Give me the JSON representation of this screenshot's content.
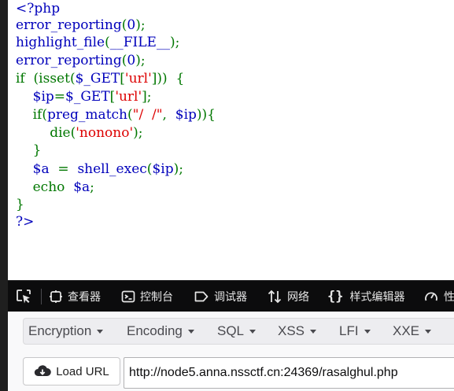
{
  "code": {
    "lines": [
      [
        {
          "t": "<?php",
          "c": "default"
        }
      ],
      [
        {
          "t": "error_reporting",
          "c": "default"
        },
        {
          "t": "(",
          "c": "keyword"
        },
        {
          "t": "0",
          "c": "default"
        },
        {
          "t": ");",
          "c": "keyword"
        }
      ],
      [
        {
          "t": "highlight_file",
          "c": "default"
        },
        {
          "t": "(",
          "c": "keyword"
        },
        {
          "t": "__FILE__",
          "c": "default"
        },
        {
          "t": ");",
          "c": "keyword"
        }
      ],
      [
        {
          "t": "error_reporting",
          "c": "default"
        },
        {
          "t": "(",
          "c": "keyword"
        },
        {
          "t": "0",
          "c": "default"
        },
        {
          "t": ");",
          "c": "keyword"
        }
      ],
      [
        {
          "t": "if  (isset(",
          "c": "keyword"
        },
        {
          "t": "$_GET",
          "c": "default"
        },
        {
          "t": "[",
          "c": "keyword"
        },
        {
          "t": "'url'",
          "c": "string"
        },
        {
          "t": "]))  {",
          "c": "keyword"
        }
      ],
      [
        {
          "t": "    ",
          "c": "keyword"
        },
        {
          "t": "$ip",
          "c": "default"
        },
        {
          "t": "=",
          "c": "keyword"
        },
        {
          "t": "$_GET",
          "c": "default"
        },
        {
          "t": "[",
          "c": "keyword"
        },
        {
          "t": "'url'",
          "c": "string"
        },
        {
          "t": "];",
          "c": "keyword"
        }
      ],
      [
        {
          "t": "    if(",
          "c": "keyword"
        },
        {
          "t": "preg_match",
          "c": "default"
        },
        {
          "t": "(",
          "c": "keyword"
        },
        {
          "t": "\"/  /\"",
          "c": "string"
        },
        {
          "t": ",  ",
          "c": "keyword"
        },
        {
          "t": "$ip",
          "c": "default"
        },
        {
          "t": ")){",
          "c": "keyword"
        }
      ],
      [
        {
          "t": "        die(",
          "c": "keyword"
        },
        {
          "t": "'nonono'",
          "c": "string"
        },
        {
          "t": ");",
          "c": "keyword"
        }
      ],
      [
        {
          "t": "    }",
          "c": "keyword"
        }
      ],
      [
        {
          "t": "    ",
          "c": "keyword"
        },
        {
          "t": "$a  ",
          "c": "default"
        },
        {
          "t": "=  ",
          "c": "keyword"
        },
        {
          "t": "shell_exec",
          "c": "default"
        },
        {
          "t": "(",
          "c": "keyword"
        },
        {
          "t": "$ip",
          "c": "default"
        },
        {
          "t": ");",
          "c": "keyword"
        }
      ],
      [
        {
          "t": "    echo  ",
          "c": "keyword"
        },
        {
          "t": "$a",
          "c": "default"
        },
        {
          "t": ";",
          "c": "keyword"
        }
      ],
      [
        {
          "t": "}",
          "c": "keyword"
        }
      ],
      [
        {
          "t": "?>",
          "c": "default"
        }
      ]
    ],
    "colors": {
      "default": "#0000bb",
      "keyword": "#007700",
      "string": "#dd0000"
    }
  },
  "devtools": {
    "tabs": [
      {
        "id": "inspector",
        "label": "查看器",
        "icon": "inspector-icon"
      },
      {
        "id": "console",
        "label": "控制台",
        "icon": "console-icon"
      },
      {
        "id": "debugger",
        "label": "调试器",
        "icon": "debugger-icon"
      },
      {
        "id": "network",
        "label": "网络",
        "icon": "network-icon"
      },
      {
        "id": "style-editor",
        "label": "样式编辑器",
        "icon": "style-editor-icon"
      },
      {
        "id": "performance",
        "label": "性",
        "icon": "performance-icon"
      }
    ],
    "picker_icon": "element-picker-icon",
    "background": "#0c0c0d"
  },
  "hackbar": {
    "menus": [
      {
        "id": "encryption",
        "label": "Encryption"
      },
      {
        "id": "encoding",
        "label": "Encoding"
      },
      {
        "id": "sql",
        "label": "SQL"
      },
      {
        "id": "xss",
        "label": "XSS"
      },
      {
        "id": "lfi",
        "label": "LFI"
      },
      {
        "id": "xxe",
        "label": "XXE"
      }
    ],
    "load_url_label": "Load URL",
    "load_url_icon": "cloud-download-icon",
    "url_value": "http://node5.anna.nssctf.cn:24369/rasalghul.php"
  }
}
